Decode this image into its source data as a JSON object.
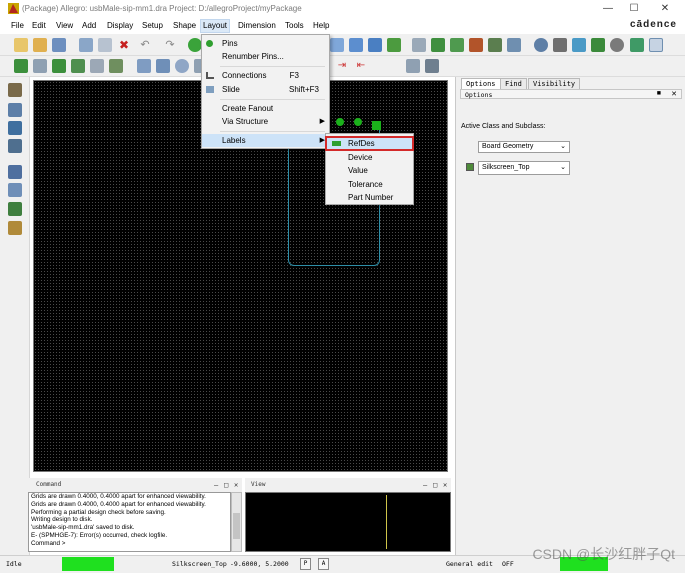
{
  "window": {
    "title": "(Package) Allegro: usbMale-sip-mm1.dra  Project: D:/allegroProject/myPackage",
    "brand": "cādence"
  },
  "menubar": [
    "File",
    "Edit",
    "View",
    "Add",
    "Display",
    "Setup",
    "Shape",
    "Layout",
    "Dimension",
    "Tools",
    "Help"
  ],
  "layout_menu": {
    "items": [
      {
        "label": "Pins",
        "shortcut": ""
      },
      {
        "label": "Renumber Pins...",
        "shortcut": ""
      },
      {
        "label": "Connections",
        "shortcut": "F3"
      },
      {
        "label": "Slide",
        "shortcut": "Shift+F3"
      },
      {
        "label": "Create Fanout",
        "shortcut": ""
      },
      {
        "label": "Via Structure",
        "shortcut": ""
      },
      {
        "label": "Labels",
        "shortcut": ""
      }
    ]
  },
  "labels_submenu": [
    "RefDes",
    "Device",
    "Value",
    "Tolerance",
    "Part Number"
  ],
  "right_panel": {
    "tabs": [
      "Options",
      "Find",
      "Visibility"
    ],
    "section_title": "Options",
    "active_class_label": "Active Class and Subclass:",
    "class_value": "Board Geometry",
    "subclass_value": "Silkscreen_Top"
  },
  "command_window": {
    "title": "Command",
    "lines": [
      "Grids are drawn 0.4000, 0.4000 apart for enhanced viewability.",
      "Grids are drawn 0.4000, 0.4000 apart for enhanced viewability.",
      "Performing a partial design check before saving.",
      "Writing design to disk.",
      "'usbMale-sip-mm1.dra' saved to disk.",
      "E- (SPMHGE-7): Error(s) occurred, check logfile.",
      "Command >"
    ]
  },
  "view_window": {
    "title": "View"
  },
  "status_bar": {
    "state": "Idle",
    "layer": "Silkscreen_Top",
    "coords": "-9.6000, 5.2000",
    "p_button": "P",
    "a_button": "A",
    "mode": "General edit",
    "off": "OFF"
  },
  "watermark": "CSDN @长沙红胖子Qt",
  "colors": {
    "canvas_bg": "#000000",
    "pad_green": "#1bb11b",
    "highlight_red": "#d42a2a",
    "menu_highlight": "#cde3f8",
    "status_green": "#1fe01f"
  }
}
